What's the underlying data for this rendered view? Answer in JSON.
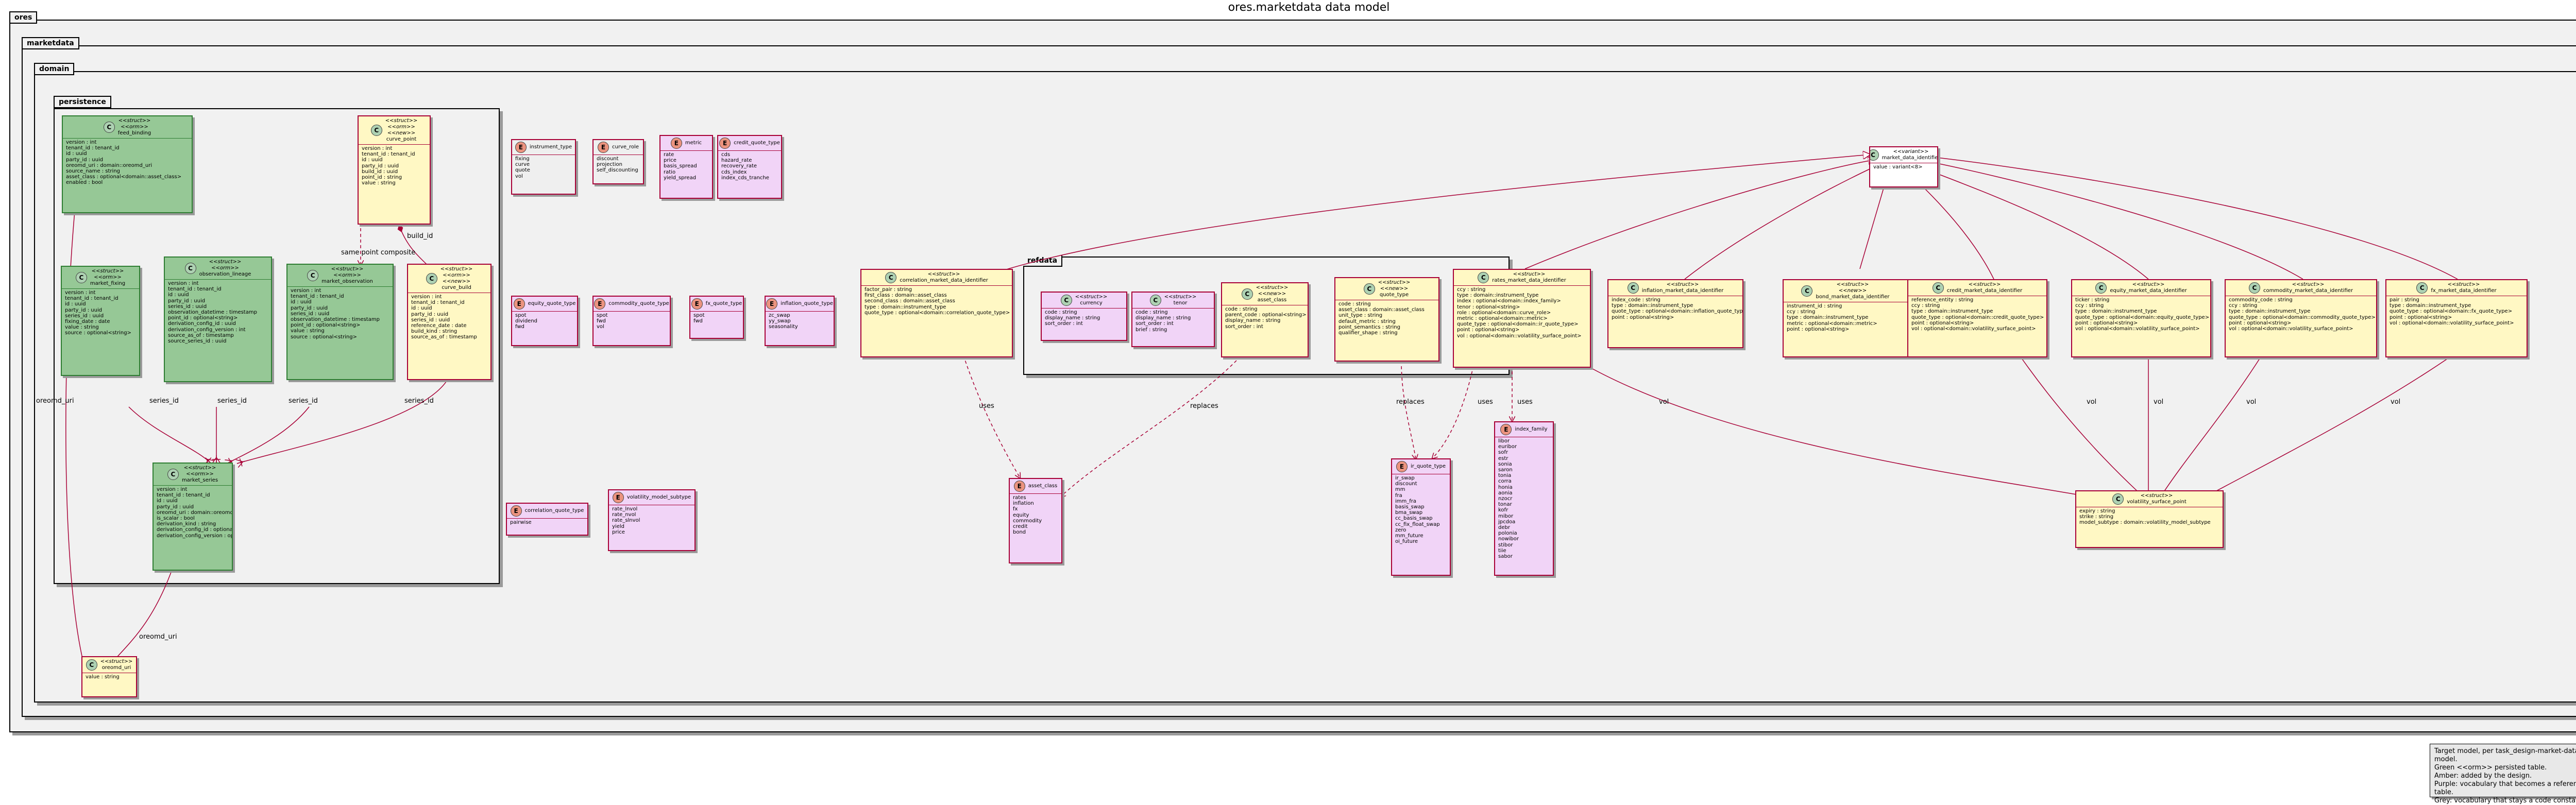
{
  "title": "ores.marketdata data model",
  "packages": {
    "ores": "ores",
    "marketdata": "marketdata",
    "domain": "domain",
    "persistence": "persistence",
    "refdata": "refdata"
  },
  "colors": {
    "green": "#96c896",
    "amber": "#fff8c4",
    "purple": "#f1d4f7",
    "grey": "#efefef",
    "border": "#a80036"
  },
  "legend": [
    "Target model, per task_design-market-data-model.",
    "Green <<orm>> persisted table.",
    "Amber: added by the design.",
    "Purple: vocabulary that becomes a reference table.",
    "Grey: vocabulary that stays a code constant."
  ],
  "edge_labels": {
    "same_point": "same point composite",
    "build_id": "build_id",
    "series_id": "series_id",
    "oreomd_uri": "oreomd_uri",
    "uses": "uses",
    "replaces": "replaces",
    "vol": "vol"
  },
  "classes": [
    {
      "id": "feed_binding",
      "kind": "c",
      "stereo": [
        "<<struct>>",
        "<<orm>>"
      ],
      "name": "feed_binding",
      "fields": [
        "version : int",
        "tenant_id : tenant_id",
        "id : uuid",
        "party_id : uuid",
        "oreomd_uri : domain::oreomd_uri",
        "source_name : string",
        "asset_class : optional<domain::asset_class>",
        "enabled : bool"
      ]
    },
    {
      "id": "curve_point",
      "kind": "c",
      "stereo": [
        "<<struct>>",
        "<<orm>>",
        "<<new>>"
      ],
      "name": "curve_point",
      "fields": [
        "version : int",
        "tenant_id : tenant_id",
        "id : uuid",
        "party_id : uuid",
        "build_id : uuid",
        "point_id : string",
        "value : string"
      ]
    },
    {
      "id": "market_fixing",
      "kind": "c",
      "stereo": [
        "<<struct>>",
        "<<orm>>"
      ],
      "name": "market_fixing",
      "fields": [
        "version : int",
        "tenant_id : tenant_id",
        "id : uuid",
        "party_id : uuid",
        "series_id : uuid",
        "fixing_date : date",
        "value : string",
        "source : optional<string>"
      ]
    },
    {
      "id": "observation_lineage",
      "kind": "c",
      "stereo": [
        "<<struct>>",
        "<<orm>>"
      ],
      "name": "observation_lineage",
      "fields": [
        "version : int",
        "tenant_id : tenant_id",
        "id : uuid",
        "party_id : uuid",
        "series_id : uuid",
        "observation_datetime : timestamp",
        "point_id : optional<string>",
        "derivation_config_id : uuid",
        "derivation_config_version : int",
        "source_as_of : timestamp",
        "source_series_id : uuid"
      ]
    },
    {
      "id": "market_observation",
      "kind": "c",
      "stereo": [
        "<<struct>>",
        "<<orm>>"
      ],
      "name": "market_observation",
      "fields": [
        "version : int",
        "tenant_id : tenant_id",
        "id : uuid",
        "party_id : uuid",
        "series_id : uuid",
        "observation_datetime : timestamp",
        "point_id : optional<string>",
        "value : string",
        "source : optional<string>"
      ]
    },
    {
      "id": "curve_build",
      "kind": "c",
      "stereo": [
        "<<struct>>",
        "<<orm>>",
        "<<new>>"
      ],
      "name": "curve_build",
      "fields": [
        "version : int",
        "tenant_id : tenant_id",
        "id : uuid",
        "party_id : uuid",
        "series_id : uuid",
        "reference_date : date",
        "build_kind : string",
        "source_as_of : timestamp"
      ]
    },
    {
      "id": "market_series",
      "kind": "c",
      "stereo": [
        "<<struct>>",
        "<<orm>>"
      ],
      "name": "market_series",
      "fields": [
        "version : int",
        "tenant_id : tenant_id",
        "id : uuid",
        "party_id : uuid",
        "oreomd_uri : domain::oreomd_uri",
        "is_scalar : bool",
        "derivation_kind : string",
        "derivation_config_id : optional<uuid>",
        "derivation_config_version : optional<int>"
      ]
    },
    {
      "id": "oreomd_uri",
      "kind": "c",
      "stereo": [
        "<<struct>>"
      ],
      "name": "oreomd_uri",
      "fields": [
        "value : string"
      ]
    },
    {
      "id": "instrument_type",
      "kind": "e",
      "stereo": [],
      "name": "instrument_type",
      "fields": [
        "fixing",
        "curve",
        "quote",
        "vol"
      ]
    },
    {
      "id": "curve_role",
      "kind": "e",
      "stereo": [],
      "name": "curve_role",
      "fields": [
        "discount",
        "projection",
        "self_discounting"
      ]
    },
    {
      "id": "metric",
      "kind": "e",
      "stereo": [],
      "name": "metric",
      "fields": [
        "rate",
        "price",
        "basis_spread",
        "ratio",
        "yield_spread"
      ]
    },
    {
      "id": "credit_quote_type",
      "kind": "e",
      "stereo": [],
      "name": "credit_quote_type",
      "fields": [
        "cds",
        "hazard_rate",
        "recovery_rate",
        "cds_index",
        "index_cds_tranche"
      ]
    },
    {
      "id": "equity_quote_type",
      "kind": "e",
      "stereo": [],
      "name": "equity_quote_type",
      "fields": [
        "spot",
        "dividend",
        "fwd"
      ]
    },
    {
      "id": "commodity_quote_type",
      "kind": "e",
      "stereo": [],
      "name": "commodity_quote_type",
      "fields": [
        "spot",
        "fwd",
        "vol"
      ]
    },
    {
      "id": "fx_quote_type",
      "kind": "e",
      "stereo": [],
      "name": "fx_quote_type",
      "fields": [
        "spot",
        "fwd"
      ]
    },
    {
      "id": "inflation_quote_type",
      "kind": "e",
      "stereo": [],
      "name": "inflation_quote_type",
      "fields": [
        "zc_swap",
        "yy_swap",
        "seasonality"
      ]
    },
    {
      "id": "correlation_quote_type",
      "kind": "e",
      "stereo": [],
      "name": "correlation_quote_type",
      "fields": [
        "pairwise"
      ]
    },
    {
      "id": "volatility_model_subtype",
      "kind": "e",
      "stereo": [],
      "name": "volatility_model_subtype",
      "fields": [
        "rate_lnvol",
        "rate_nvol",
        "rate_slnvol",
        "yield",
        "price"
      ]
    },
    {
      "id": "correlation_id",
      "kind": "c",
      "stereo": [
        "<<struct>>"
      ],
      "name": "correlation_market_data_identifier",
      "fields": [
        "factor_pair : string",
        "first_class : domain::asset_class",
        "second_class : domain::asset_class",
        "type : domain::instrument_type",
        "quote_type : optional<domain::correlation_quote_type>"
      ]
    },
    {
      "id": "currency",
      "kind": "c",
      "stereo": [
        "<<struct>>"
      ],
      "name": "currency",
      "fields": [
        "code : string",
        "display_name : string",
        "sort_order : int"
      ]
    },
    {
      "id": "tenor",
      "kind": "c",
      "stereo": [
        "<<struct>>"
      ],
      "name": "tenor",
      "fields": [
        "code : string",
        "display_name : string",
        "sort_order : int",
        "brief : string"
      ]
    },
    {
      "id": "asset_class_ref",
      "kind": "c",
      "stereo": [
        "<<struct>>",
        "<<new>>"
      ],
      "name": "asset_class",
      "fields": [
        "code : string",
        "parent_code : optional<string>",
        "display_name : string",
        "sort_order : int"
      ]
    },
    {
      "id": "quote_type",
      "kind": "c",
      "stereo": [
        "<<struct>>",
        "<<new>>"
      ],
      "name": "quote_type",
      "fields": [
        "code : string",
        "asset_class : domain::asset_class",
        "unit_type : string",
        "default_metric : string",
        "point_semantics : string",
        "qualifier_shape : string"
      ]
    },
    {
      "id": "rates_id",
      "kind": "c",
      "stereo": [
        "<<struct>>"
      ],
      "name": "rates_market_data_identifier",
      "fields": [
        "ccy : string",
        "type : domain::instrument_type",
        "index : optional<domain::index_family>",
        "tenor : optional<string>",
        "role : optional<domain::curve_role>",
        "metric : optional<domain::metric>",
        "quote_type : optional<domain::ir_quote_type>",
        "point : optional<string>",
        "vol : optional<domain::volatility_surface_point>"
      ]
    },
    {
      "id": "inflation_id",
      "kind": "c",
      "stereo": [
        "<<struct>>"
      ],
      "name": "inflation_market_data_identifier",
      "fields": [
        "index_code : string",
        "type : domain::instrument_type",
        "quote_type : optional<domain::inflation_quote_type>",
        "point : optional<string>"
      ]
    },
    {
      "id": "bond_id",
      "kind": "c",
      "stereo": [
        "<<struct>>",
        "<<new>>"
      ],
      "name": "bond_market_data_identifier",
      "fields": [
        "instrument_id : string",
        "ccy : string",
        "type : domain::instrument_type",
        "metric : optional<domain::metric>",
        "point : optional<string>"
      ]
    },
    {
      "id": "credit_id",
      "kind": "c",
      "stereo": [
        "<<struct>>"
      ],
      "name": "credit_market_data_identifier",
      "fields": [
        "reference_entity : string",
        "ccy : string",
        "type : domain::instrument_type",
        "quote_type : optional<domain::credit_quote_type>",
        "point : optional<string>",
        "vol : optional<domain::volatility_surface_point>"
      ]
    },
    {
      "id": "equity_id",
      "kind": "c",
      "stereo": [
        "<<struct>>"
      ],
      "name": "equity_market_data_identifier",
      "fields": [
        "ticker : string",
        "ccy : string",
        "type : domain::instrument_type",
        "quote_type : optional<domain::equity_quote_type>",
        "point : optional<string>",
        "vol : optional<domain::volatility_surface_point>"
      ]
    },
    {
      "id": "commodity_id",
      "kind": "c",
      "stereo": [
        "<<struct>>"
      ],
      "name": "commodity_market_data_identifier",
      "fields": [
        "commodity_code : string",
        "ccy : string",
        "type : domain::instrument_type",
        "quote_type : optional<domain::commodity_quote_type>",
        "point : optional<string>",
        "vol : optional<domain::volatility_surface_point>"
      ]
    },
    {
      "id": "fx_id",
      "kind": "c",
      "stereo": [
        "<<struct>>"
      ],
      "name": "fx_market_data_identifier",
      "fields": [
        "pair : string",
        "type : domain::instrument_type",
        "quote_type : optional<domain::fx_quote_type>",
        "point : optional<string>",
        "vol : optional<domain::volatility_surface_point>"
      ]
    },
    {
      "id": "market_data_identifier",
      "kind": "c",
      "stereo": [
        "<<variant>>"
      ],
      "name": "market_data_identifier",
      "fields": [
        "value : variant<8>"
      ]
    },
    {
      "id": "asset_class_enum",
      "kind": "e",
      "stereo": [],
      "name": "asset_class",
      "fields": [
        "rates",
        "inflation",
        "fx",
        "equity",
        "commodity",
        "credit",
        "bond"
      ]
    },
    {
      "id": "ir_quote_type",
      "kind": "e",
      "stereo": [],
      "name": "ir_quote_type",
      "fields": [
        "ir_swap",
        "discount",
        "mm",
        "fra",
        "imm_fra",
        "basis_swap",
        "bma_swap",
        "cc_basis_swap",
        "cc_fix_float_swap",
        "zero",
        "mm_future",
        "oi_future"
      ]
    },
    {
      "id": "index_family",
      "kind": "e",
      "stereo": [],
      "name": "index_family",
      "fields": [
        "libor",
        "euribor",
        "sofr",
        "estr",
        "sonia",
        "saron",
        "tonia",
        "corra",
        "honia",
        "aonia",
        "nzocr",
        "tonar",
        "kofr",
        "mibor",
        "jpcdoa",
        "debr",
        "polonia",
        "nowibor",
        "stibor",
        "tiie",
        "sabor"
      ]
    },
    {
      "id": "vol_surface_point",
      "kind": "c",
      "stereo": [
        "<<struct>>"
      ],
      "name": "volatility_surface_point",
      "fields": [
        "expiry : string",
        "strike : string",
        "model_subtype : domain::volatility_model_subtype"
      ]
    }
  ]
}
